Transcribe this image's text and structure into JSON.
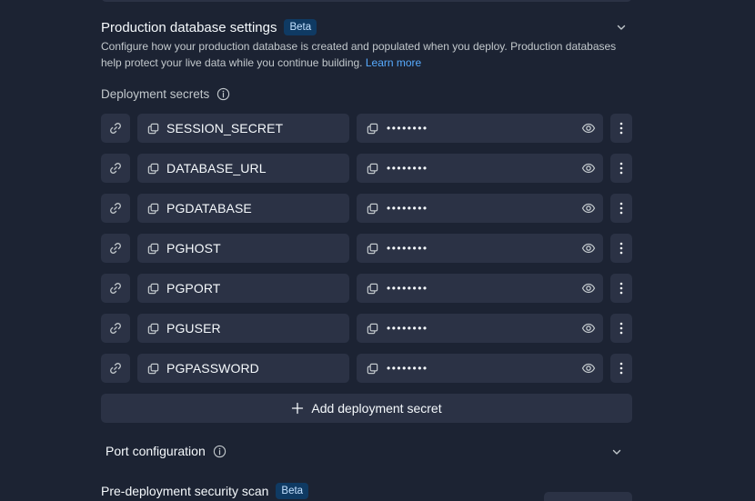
{
  "production": {
    "title": "Production database settings",
    "badge": "Beta",
    "description": "Configure how your production database is created and populated when you deploy. Production databases help protect your live data while you continue building.",
    "learn_more": "Learn more"
  },
  "secrets": {
    "label": "Deployment secrets",
    "masked_value": "••••••••",
    "items": [
      {
        "key": "SESSION_SECRET"
      },
      {
        "key": "DATABASE_URL"
      },
      {
        "key": "PGDATABASE"
      },
      {
        "key": "PGHOST"
      },
      {
        "key": "PGPORT"
      },
      {
        "key": "PGUSER"
      },
      {
        "key": "PGPASSWORD"
      }
    ],
    "add_label": "Add deployment secret"
  },
  "port": {
    "label": "Port configuration"
  },
  "scan": {
    "label": "Pre-deployment security scan",
    "badge": "Beta"
  },
  "icons": {
    "link": "link-icon",
    "copy": "copy-icon",
    "eye": "eye-icon",
    "more": "more-vertical-icon",
    "plus": "plus-icon",
    "info": "info-icon",
    "chevron": "chevron-down-icon"
  },
  "colors": {
    "background": "#1c2333",
    "surface": "#2b3245",
    "badge_bg": "#0f3a63",
    "link": "#57abff"
  }
}
